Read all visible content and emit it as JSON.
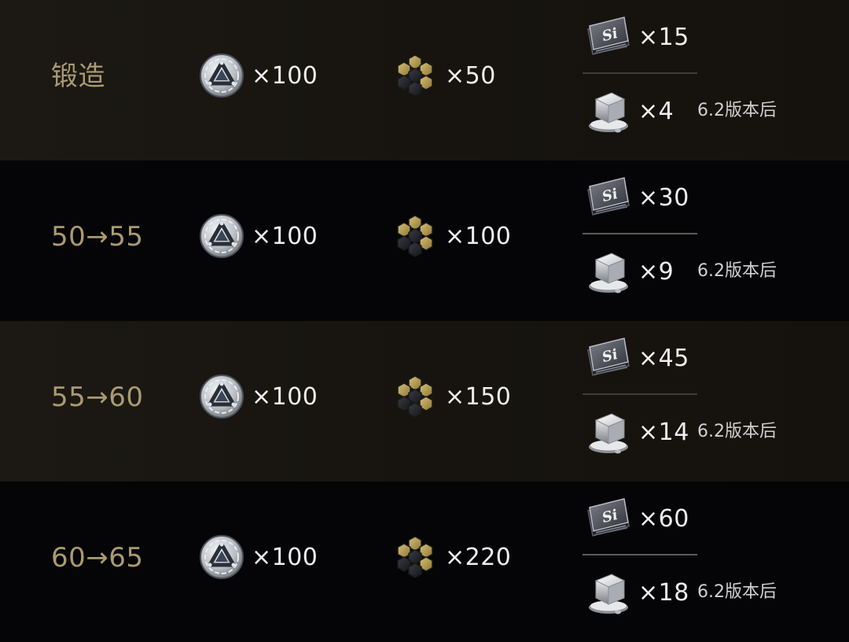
{
  "rows": [
    {
      "label": "锻造",
      "coin_qty": "×100",
      "comb_qty": "×50",
      "chip_qty": "×15",
      "cube_qty": "×4",
      "note": "6.2版本后"
    },
    {
      "label": "50→55",
      "coin_qty": "×100",
      "comb_qty": "×100",
      "chip_qty": "×30",
      "cube_qty": "×9",
      "note": "6.2版本后"
    },
    {
      "label": "55→60",
      "coin_qty": "×100",
      "comb_qty": "×150",
      "chip_qty": "×45",
      "cube_qty": "×14",
      "note": "6.2版本后"
    },
    {
      "label": "60→65",
      "coin_qty": "×100",
      "comb_qty": "×220",
      "chip_qty": "×60",
      "cube_qty": "×18",
      "note": "6.2版本后"
    }
  ],
  "icons": {
    "coin": "triangle-coin-icon",
    "comb": "honeycomb-alloy-icon",
    "chip": "silicon-chip-icon",
    "cube": "metal-cube-icon"
  },
  "chip_text": "Si",
  "colors": {
    "label": "#aa9a72",
    "quantity": "#eeeeee",
    "note": "#d0d0d0",
    "row_alt": "#1a1712",
    "row_dark": "#050507"
  }
}
